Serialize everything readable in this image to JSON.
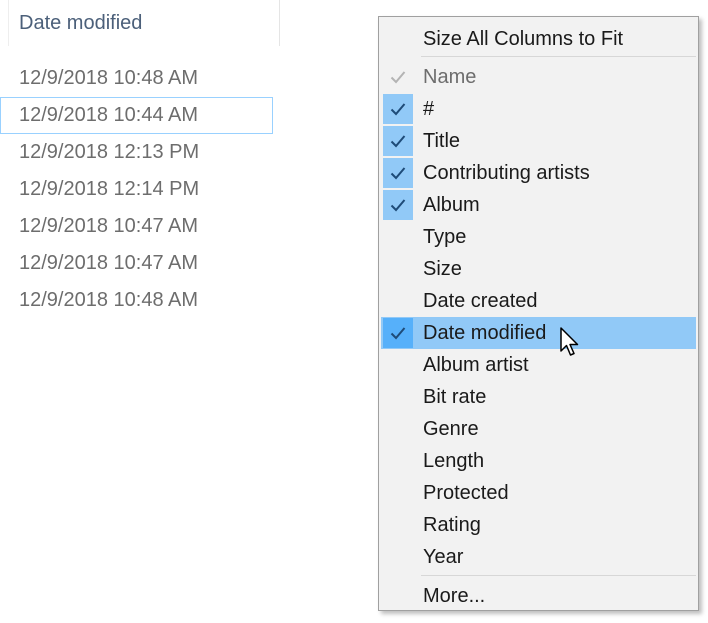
{
  "column": {
    "header": "Date modified",
    "rows": [
      "12/9/2018 10:48 AM",
      "12/9/2018 10:44 AM",
      "12/9/2018 12:13 PM",
      "12/9/2018 12:14 PM",
      "12/9/2018 10:47 AM",
      "12/9/2018 10:47 AM",
      "12/9/2018 10:48 AM"
    ],
    "focused_row": 1
  },
  "menu": {
    "size_all": "Size All Columns to Fit",
    "more": "More...",
    "columns": [
      {
        "label": "Name",
        "checked": true,
        "disabled": true
      },
      {
        "label": "#",
        "checked": true
      },
      {
        "label": "Title",
        "checked": true
      },
      {
        "label": "Contributing artists",
        "checked": true
      },
      {
        "label": "Album",
        "checked": true
      },
      {
        "label": "Type",
        "checked": false
      },
      {
        "label": "Size",
        "checked": false
      },
      {
        "label": "Date created",
        "checked": false
      },
      {
        "label": "Date modified",
        "checked": true,
        "highlighted": true
      },
      {
        "label": "Album artist",
        "checked": false
      },
      {
        "label": "Bit rate",
        "checked": false
      },
      {
        "label": "Genre",
        "checked": false
      },
      {
        "label": "Length",
        "checked": false
      },
      {
        "label": "Protected",
        "checked": false
      },
      {
        "label": "Rating",
        "checked": false
      },
      {
        "label": "Year",
        "checked": false
      }
    ]
  },
  "colors": {
    "check_bg": "#91c9f7",
    "highlight_bg": "#91c9f7",
    "highlight_check_bg": "#56b0fa",
    "check_mark": "#1e4b78",
    "disabled_check": "#b4b4b4"
  }
}
